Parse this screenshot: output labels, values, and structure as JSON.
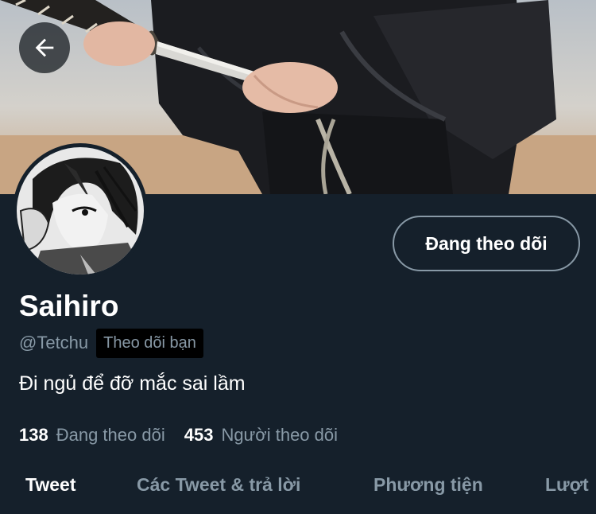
{
  "profile": {
    "display_name": "Saihiro",
    "handle": "@Tetchu",
    "follows_you_badge": "Theo dõi bạn",
    "bio": "Đi ngủ để đỡ mắc sai lầm",
    "follow_button_label": "Đang theo dõi"
  },
  "stats": {
    "following_count": "138",
    "following_label": "Đang theo dõi",
    "followers_count": "453",
    "followers_label": "Người theo dõi"
  },
  "tabs": [
    {
      "label": "Tweet",
      "active": true
    },
    {
      "label": "Các Tweet & trả lời",
      "active": false
    },
    {
      "label": "Phương tiện",
      "active": false
    },
    {
      "label": "Lượt",
      "active": false
    }
  ],
  "icons": {
    "back": "arrow-left-icon"
  },
  "colors": {
    "background": "#15202b",
    "secondary_text": "#8899a6",
    "primary_text": "#ffffff",
    "button_border": "#8899a6"
  }
}
